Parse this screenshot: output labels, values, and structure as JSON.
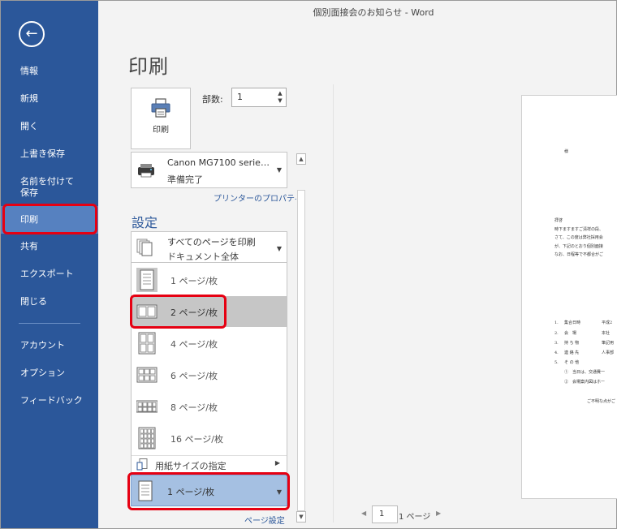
{
  "window": {
    "title": "個別面接会のお知らせ - Word"
  },
  "sidebar": {
    "items": [
      {
        "label": "情報"
      },
      {
        "label": "新規"
      },
      {
        "label": "開く"
      },
      {
        "label": "上書き保存"
      },
      {
        "label": "名前を付けて\n保存"
      },
      {
        "label": "印刷"
      },
      {
        "label": "共有"
      },
      {
        "label": "エクスポート"
      },
      {
        "label": "閉じる"
      },
      {
        "label": "アカウント"
      },
      {
        "label": "オプション"
      },
      {
        "label": "フィードバック"
      }
    ],
    "active": "印刷"
  },
  "print": {
    "title": "印刷",
    "button_label": "印刷",
    "copies_label": "部数:",
    "copies_value": "1"
  },
  "printer": {
    "name": "Canon MG7100 serie…",
    "status": "準備完了",
    "properties_link": "プリンターのプロパティ"
  },
  "settings": {
    "title": "設定",
    "pages_main": "すべてのページを印刷",
    "pages_sub": "ドキュメント全体"
  },
  "pages_per_sheet": {
    "options": [
      {
        "label": "1 ページ/枚"
      },
      {
        "label": "2 ページ/枚"
      },
      {
        "label": "4 ページ/枚"
      },
      {
        "label": "6 ページ/枚"
      },
      {
        "label": "8 ページ/枚"
      },
      {
        "label": "16 ページ/枚"
      }
    ],
    "hovered": "2 ページ/枚",
    "paper_size_label": "用紙サイズの指定",
    "selected": "1 ページ/枚"
  },
  "page_setup_link": "ページ設定",
  "preview": {
    "page_number": "1",
    "page_total": "1 ページ",
    "doc_lines": {
      "salutation": "様",
      "greeting": "拝啓",
      "p1": "時下ますますご清祥の段、",
      "p2": "さて、この度は弊社採用会",
      "p3": "が、下記のとおり個別面接",
      "p4": "なお、日程等で不都合がご",
      "i1n": "1.",
      "i1k": "集合日時",
      "i1v": "平成2",
      "i2n": "2.",
      "i2k": "会　場",
      "i2v": "本社",
      "i3n": "3.",
      "i3k": "持 ち 物",
      "i3v": "筆記用",
      "i4n": "4.",
      "i4k": "連 絡 先",
      "i4v": "人事部",
      "i5n": "5.",
      "i5k": "そ の 他",
      "n1": "①　当日は、交通費一",
      "n2": "②　会場案内図はホー",
      "closing": "ご不明な点がご"
    }
  },
  "colors": {
    "accent": "#2b579a",
    "sidebar_active": "#5681c0",
    "selected_option": "#a5c0e2",
    "callout": "#e60012"
  }
}
